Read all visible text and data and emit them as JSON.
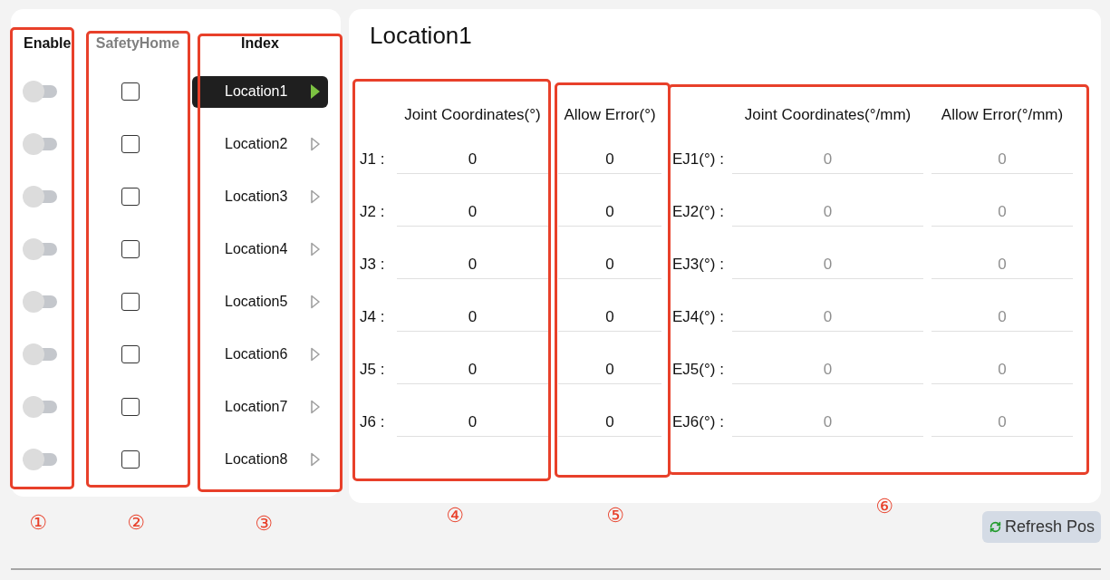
{
  "columns": [
    {
      "label": "Enable",
      "disabled": false
    },
    {
      "label": "SafetyHome",
      "disabled": true
    },
    {
      "label": "Index",
      "disabled": false
    }
  ],
  "locations": [
    {
      "enabled": false,
      "safety_home": false,
      "name": "Location1",
      "selected": true
    },
    {
      "enabled": false,
      "safety_home": false,
      "name": "Location2",
      "selected": false
    },
    {
      "enabled": false,
      "safety_home": false,
      "name": "Location3",
      "selected": false
    },
    {
      "enabled": false,
      "safety_home": false,
      "name": "Location4",
      "selected": false
    },
    {
      "enabled": false,
      "safety_home": false,
      "name": "Location5",
      "selected": false
    },
    {
      "enabled": false,
      "safety_home": false,
      "name": "Location6",
      "selected": false
    },
    {
      "enabled": false,
      "safety_home": false,
      "name": "Location7",
      "selected": false
    },
    {
      "enabled": false,
      "safety_home": false,
      "name": "Location8",
      "selected": false
    }
  ],
  "detail": {
    "title": "Location1",
    "joints": {
      "headers": [
        "Joint Coordinates(°)",
        "Allow Error(°)"
      ],
      "rows": [
        {
          "label": "J1 :",
          "value": "0",
          "error": "0",
          "disabled": false
        },
        {
          "label": "J2 :",
          "value": "0",
          "error": "0",
          "disabled": false
        },
        {
          "label": "J3 :",
          "value": "0",
          "error": "0",
          "disabled": false
        },
        {
          "label": "J4 :",
          "value": "0",
          "error": "0",
          "disabled": false
        },
        {
          "label": "J5 :",
          "value": "0",
          "error": "0",
          "disabled": false
        },
        {
          "label": "J6 :",
          "value": "0",
          "error": "0",
          "disabled": false
        }
      ]
    },
    "external_joints": {
      "headers": [
        "Joint Coordinates(°/mm)",
        "Allow Error(°/mm)"
      ],
      "rows": [
        {
          "label": "EJ1(°) :",
          "value": "0",
          "error": "0",
          "disabled": true
        },
        {
          "label": "EJ2(°) :",
          "value": "0",
          "error": "0",
          "disabled": true
        },
        {
          "label": "EJ3(°) :",
          "value": "0",
          "error": "0",
          "disabled": true
        },
        {
          "label": "EJ4(°) :",
          "value": "0",
          "error": "0",
          "disabled": true
        },
        {
          "label": "EJ5(°) :",
          "value": "0",
          "error": "0",
          "disabled": true
        },
        {
          "label": "EJ6(°) :",
          "value": "0",
          "error": "0",
          "disabled": true
        }
      ]
    }
  },
  "refresh_button": {
    "label": "Refresh Pos"
  },
  "annotations": [
    {
      "label": "①"
    },
    {
      "label": "②"
    },
    {
      "label": "③"
    },
    {
      "label": "④"
    },
    {
      "label": "⑤"
    },
    {
      "label": "⑥"
    }
  ]
}
